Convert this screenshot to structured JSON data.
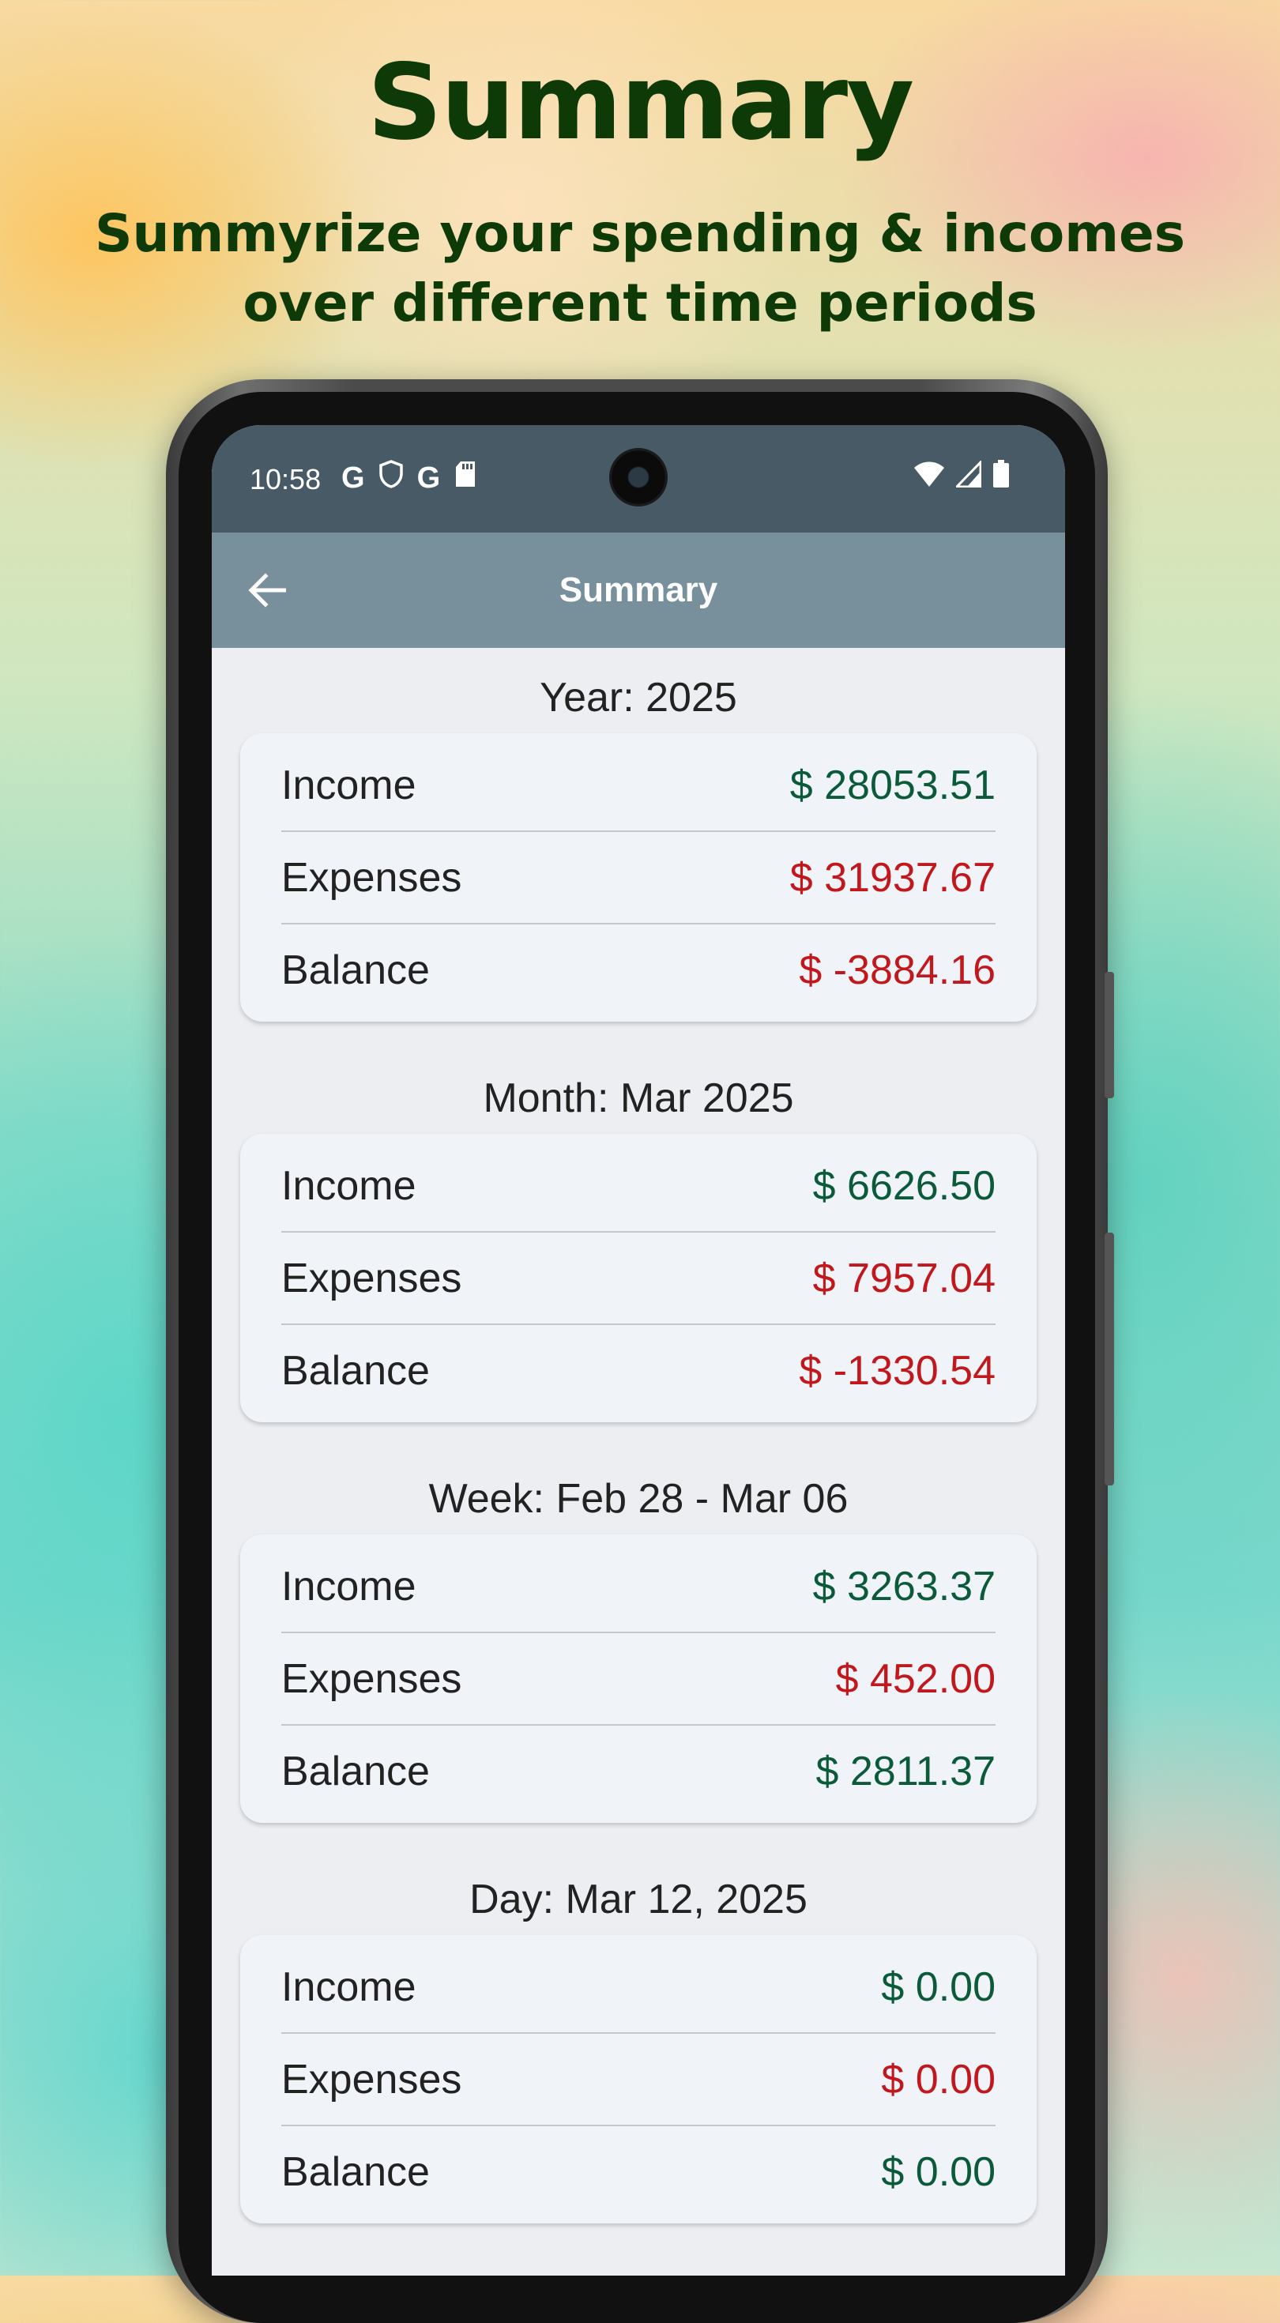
{
  "promo": {
    "title": "Summary",
    "subtitle": "Summyrize your spending & incomes over different time periods"
  },
  "status_bar": {
    "time": "10:58",
    "icons_left": [
      "google-icon",
      "shield-icon",
      "google-icon",
      "sd-card-icon"
    ],
    "icons_right": [
      "wifi-icon",
      "signal-icon",
      "battery-icon"
    ]
  },
  "app_bar": {
    "title": "Summary",
    "back_icon": "arrow-left-icon"
  },
  "sections": [
    {
      "header": "Year: 2025",
      "rows": [
        {
          "label": "Income",
          "value": "$ 28053.51",
          "tone": "positive"
        },
        {
          "label": "Expenses",
          "value": "$ 31937.67",
          "tone": "negative"
        },
        {
          "label": "Balance",
          "value": "$ -3884.16",
          "tone": "negative"
        }
      ]
    },
    {
      "header": "Month: Mar 2025",
      "rows": [
        {
          "label": "Income",
          "value": "$ 6626.50",
          "tone": "positive"
        },
        {
          "label": "Expenses",
          "value": "$ 7957.04",
          "tone": "negative"
        },
        {
          "label": "Balance",
          "value": "$ -1330.54",
          "tone": "negative"
        }
      ]
    },
    {
      "header": "Week: Feb 28 - Mar 06",
      "rows": [
        {
          "label": "Income",
          "value": "$ 3263.37",
          "tone": "positive"
        },
        {
          "label": "Expenses",
          "value": "$ 452.00",
          "tone": "negative"
        },
        {
          "label": "Balance",
          "value": "$ 2811.37",
          "tone": "positive"
        }
      ]
    },
    {
      "header": "Day: Mar 12, 2025",
      "rows": [
        {
          "label": "Income",
          "value": "$ 0.00",
          "tone": "positive"
        },
        {
          "label": "Expenses",
          "value": "$ 0.00",
          "tone": "negative"
        },
        {
          "label": "Balance",
          "value": "$ 0.00",
          "tone": "positive"
        }
      ]
    }
  ],
  "colors": {
    "status_bar": "#475a66",
    "app_bar": "#78909c",
    "positive": "#0b5a3a",
    "negative": "#c0181c",
    "promo_text": "#0d3a07"
  }
}
